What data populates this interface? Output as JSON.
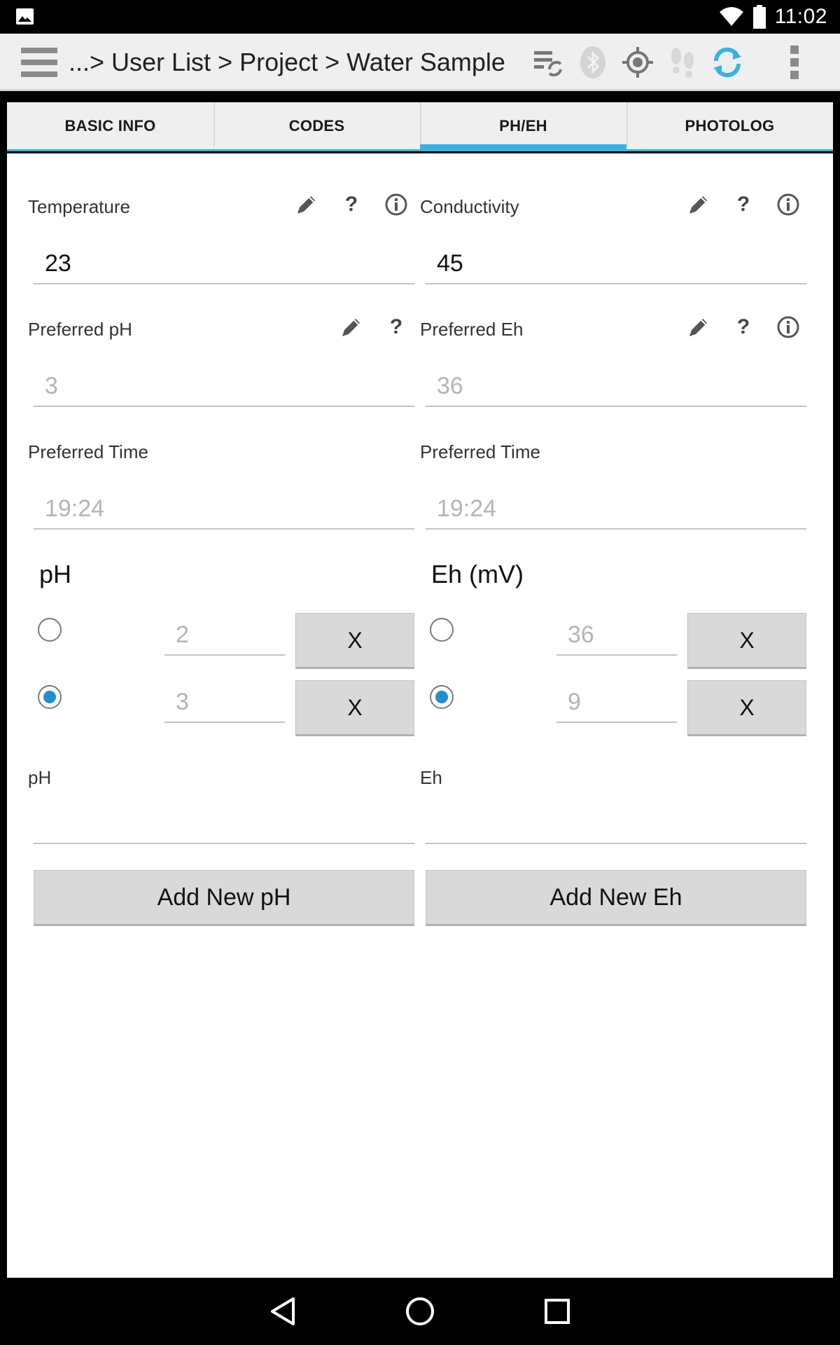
{
  "status_bar": {
    "time": "11:02",
    "icons": [
      "image-icon",
      "wifi-icon",
      "battery-icon"
    ]
  },
  "action_bar": {
    "breadcrumb": "...> User List > Project > Water Sample",
    "icons": [
      "menu-icon",
      "sync-settings-icon",
      "bluetooth-icon",
      "gps-icon",
      "footsteps-icon",
      "refresh-icon",
      "overflow-menu-icon"
    ],
    "accent_color": "#35b4e4"
  },
  "tabs": [
    {
      "label": "BASIC INFO",
      "active": false
    },
    {
      "label": "CODES",
      "active": false
    },
    {
      "label": "PH/EH",
      "active": true
    },
    {
      "label": "PHOTOLOG",
      "active": false
    }
  ],
  "left": {
    "temperature_label": "Temperature",
    "temperature_value": "23",
    "preferred_ph_label": "Preferred pH",
    "preferred_ph_value": "3",
    "preferred_time_label": "Preferred Time",
    "preferred_time_value": "19:24",
    "section_title": "pH",
    "entries": [
      {
        "value": "2",
        "selected": false,
        "remove_label": "X"
      },
      {
        "value": "3",
        "selected": true,
        "remove_label": "X"
      }
    ],
    "new_label": "pH",
    "new_value": "",
    "add_button": "Add New pH"
  },
  "right": {
    "conductivity_label": "Conductivity",
    "conductivity_value": "45",
    "preferred_eh_label": "Preferred Eh",
    "preferred_eh_value": "36",
    "preferred_time_label": "Preferred Time",
    "preferred_time_value": "19:24",
    "section_title": "Eh (mV)",
    "entries": [
      {
        "value": "36",
        "selected": false,
        "remove_label": "X"
      },
      {
        "value": "9",
        "selected": true,
        "remove_label": "X"
      }
    ],
    "new_label": "Eh",
    "new_value": "",
    "add_button": "Add New Eh"
  },
  "field_icons": {
    "edit": "pencil-icon",
    "help": "?",
    "info": "info-icon"
  },
  "nav_bar": [
    "back-icon",
    "home-icon",
    "recents-icon"
  ]
}
